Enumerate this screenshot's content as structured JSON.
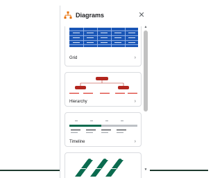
{
  "panel": {
    "title": "Diagrams",
    "close_glyph": "✕",
    "header_icon": "diagram-icon",
    "colors": {
      "accent_orange": "#e8710a",
      "grid_blue": "#1a56b6",
      "hierarchy_red": "#b3261e",
      "timeline_green": "#0b6b4f"
    }
  },
  "cards": [
    {
      "label": "Grid",
      "chevron": "›"
    },
    {
      "label": "Hierarchy",
      "chevron": "›"
    },
    {
      "label": "Timeline",
      "chevron": "›"
    }
  ],
  "scrollbar": {
    "up": "▲",
    "down": "▼"
  }
}
